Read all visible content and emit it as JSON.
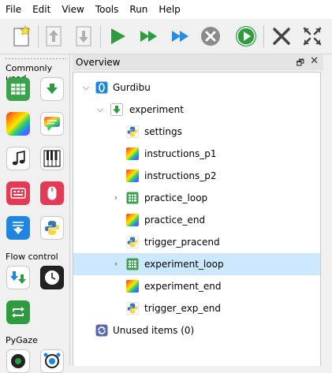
{
  "menubar": {
    "items": [
      "File",
      "Edit",
      "View",
      "Tools",
      "Run",
      "Help"
    ]
  },
  "toolbar": {
    "buttons": [
      "new-file-icon",
      "move-up-icon",
      "move-down-icon",
      "run-icon",
      "run-fast-icon",
      "run-quick-icon",
      "stop-icon",
      "run-in-window-icon",
      "close-all-icon",
      "fullscreen-icon"
    ]
  },
  "sidebar": {
    "sections": [
      {
        "label": "Commonly used"
      },
      {
        "label": "Flow control"
      },
      {
        "label": "PyGaze"
      }
    ],
    "tools": [
      "loop-icon",
      "sequence-icon",
      "sketchpad-icon",
      "feedback-icon",
      "sampler-icon",
      "synth-icon",
      "form-icon",
      "mouse-response-icon",
      "logger-icon",
      "inline-script-icon",
      "parallel-icon",
      "clock-icon",
      "repeat-icon",
      "pygaze-init-icon",
      "pygaze-start-icon"
    ]
  },
  "overview": {
    "title": "Overview",
    "float_symbol": "🗗",
    "close_symbol": "✕"
  },
  "tree": {
    "items": [
      {
        "label": "Gurdibu",
        "icon": "opensesame-icon"
      },
      {
        "label": "experiment",
        "icon": "sequence-icon"
      },
      {
        "label": "settings",
        "icon": "inline-script-icon"
      },
      {
        "label": "instructions_p1",
        "icon": "sketchpad-icon"
      },
      {
        "label": "instructions_p2",
        "icon": "sketchpad-icon"
      },
      {
        "label": "practice_loop",
        "icon": "loop-icon"
      },
      {
        "label": "practice_end",
        "icon": "sketchpad-icon"
      },
      {
        "label": "trigger_pracend",
        "icon": "inline-script-icon"
      },
      {
        "label": "experiment_loop",
        "icon": "loop-icon"
      },
      {
        "label": "experiment_end",
        "icon": "sketchpad-icon"
      },
      {
        "label": "trigger_exp_end",
        "icon": "inline-script-icon"
      },
      {
        "label": "Unused items (0)",
        "icon": "unused-items-icon"
      }
    ]
  },
  "colors": {
    "accent_green": "#2e9b3e",
    "selection": "#cce8ff",
    "run_blue": "#2a8be0"
  }
}
